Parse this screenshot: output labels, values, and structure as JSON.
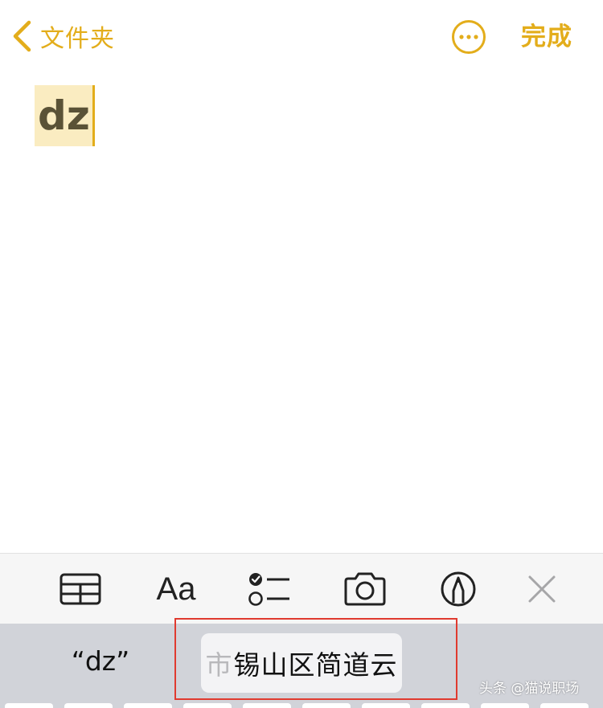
{
  "nav": {
    "back_label": "文件夹",
    "done_label": "完成"
  },
  "note": {
    "title": "dz"
  },
  "toolbar": {
    "tools": [
      "table-icon",
      "text-format",
      "checklist-icon",
      "camera-icon",
      "markup-pen-icon",
      "close-icon"
    ],
    "format_label": "Aa"
  },
  "suggestions": {
    "left": "“dz”",
    "middle_fade": "市",
    "middle": "锡山区简道云"
  },
  "watermark": "头条 @猫说职场",
  "colors": {
    "accent": "#e3ad1b",
    "title_highlight": "#faecc1",
    "suggestion_bar": "#d1d3d9",
    "annotation_box": "#e03a2f"
  }
}
